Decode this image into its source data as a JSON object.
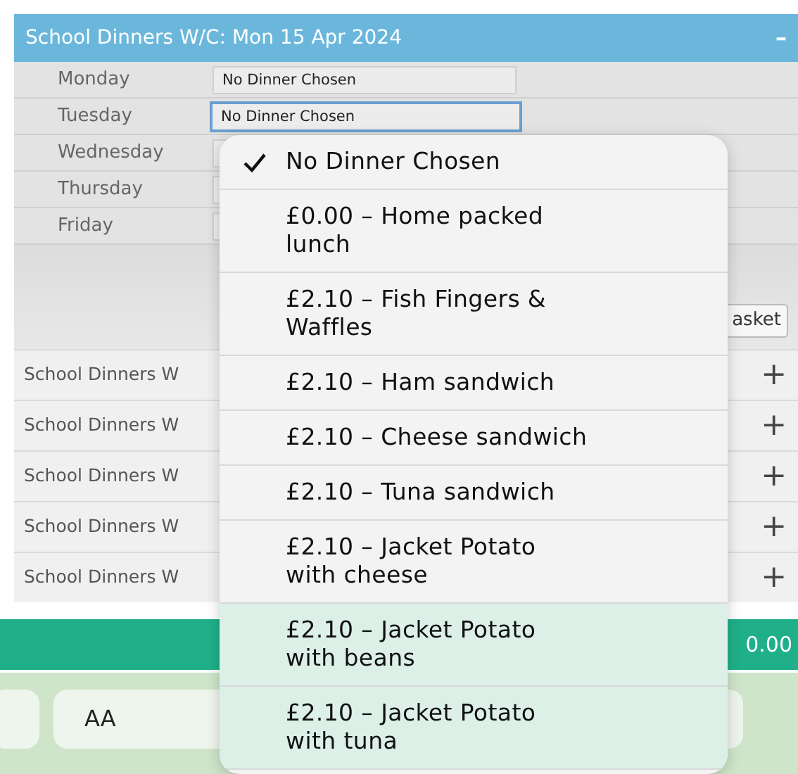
{
  "panel": {
    "title": "School Dinners W/C: Mon 15 Apr 2024",
    "collapse_symbol": "–"
  },
  "days": [
    {
      "label": "Monday",
      "value": "No Dinner Chosen",
      "focused": false
    },
    {
      "label": "Tuesday",
      "value": "No Dinner Chosen",
      "focused": true
    },
    {
      "label": "Wednesday",
      "focused": false
    },
    {
      "label": "Thursday",
      "focused": false
    },
    {
      "label": "Friday",
      "focused": false
    }
  ],
  "basket_button": "asket",
  "collapsed_weeks": [
    {
      "title": "School Dinners W",
      "expand_symbol": "+"
    },
    {
      "title": "School Dinners W",
      "expand_symbol": "+"
    },
    {
      "title": "School Dinners W",
      "expand_symbol": "+"
    },
    {
      "title": "School Dinners W",
      "expand_symbol": "+"
    },
    {
      "title": "School Dinners W",
      "expand_symbol": "+"
    }
  ],
  "total_bar": {
    "amount": "0.00"
  },
  "keyboard_bar": {
    "text_size_button": "AA"
  },
  "dropdown": [
    {
      "label": "No Dinner Chosen",
      "selected": true
    },
    {
      "label": "£0.00 – Home packed lunch",
      "selected": false
    },
    {
      "label": "£2.10 – Fish Fingers & Waffles",
      "selected": false
    },
    {
      "label": "£2.10 – Ham sandwich",
      "selected": false
    },
    {
      "label": "£2.10 – Cheese sandwich",
      "selected": false
    },
    {
      "label": "£2.10 – Tuna sandwich",
      "selected": false
    },
    {
      "label": "£2.10 – Jacket Potato with cheese",
      "selected": false
    },
    {
      "label": "£2.10 – Jacket Potato with beans",
      "selected": false
    },
    {
      "label": "£2.10 – Jacket Potato with tuna",
      "selected": false
    }
  ]
}
